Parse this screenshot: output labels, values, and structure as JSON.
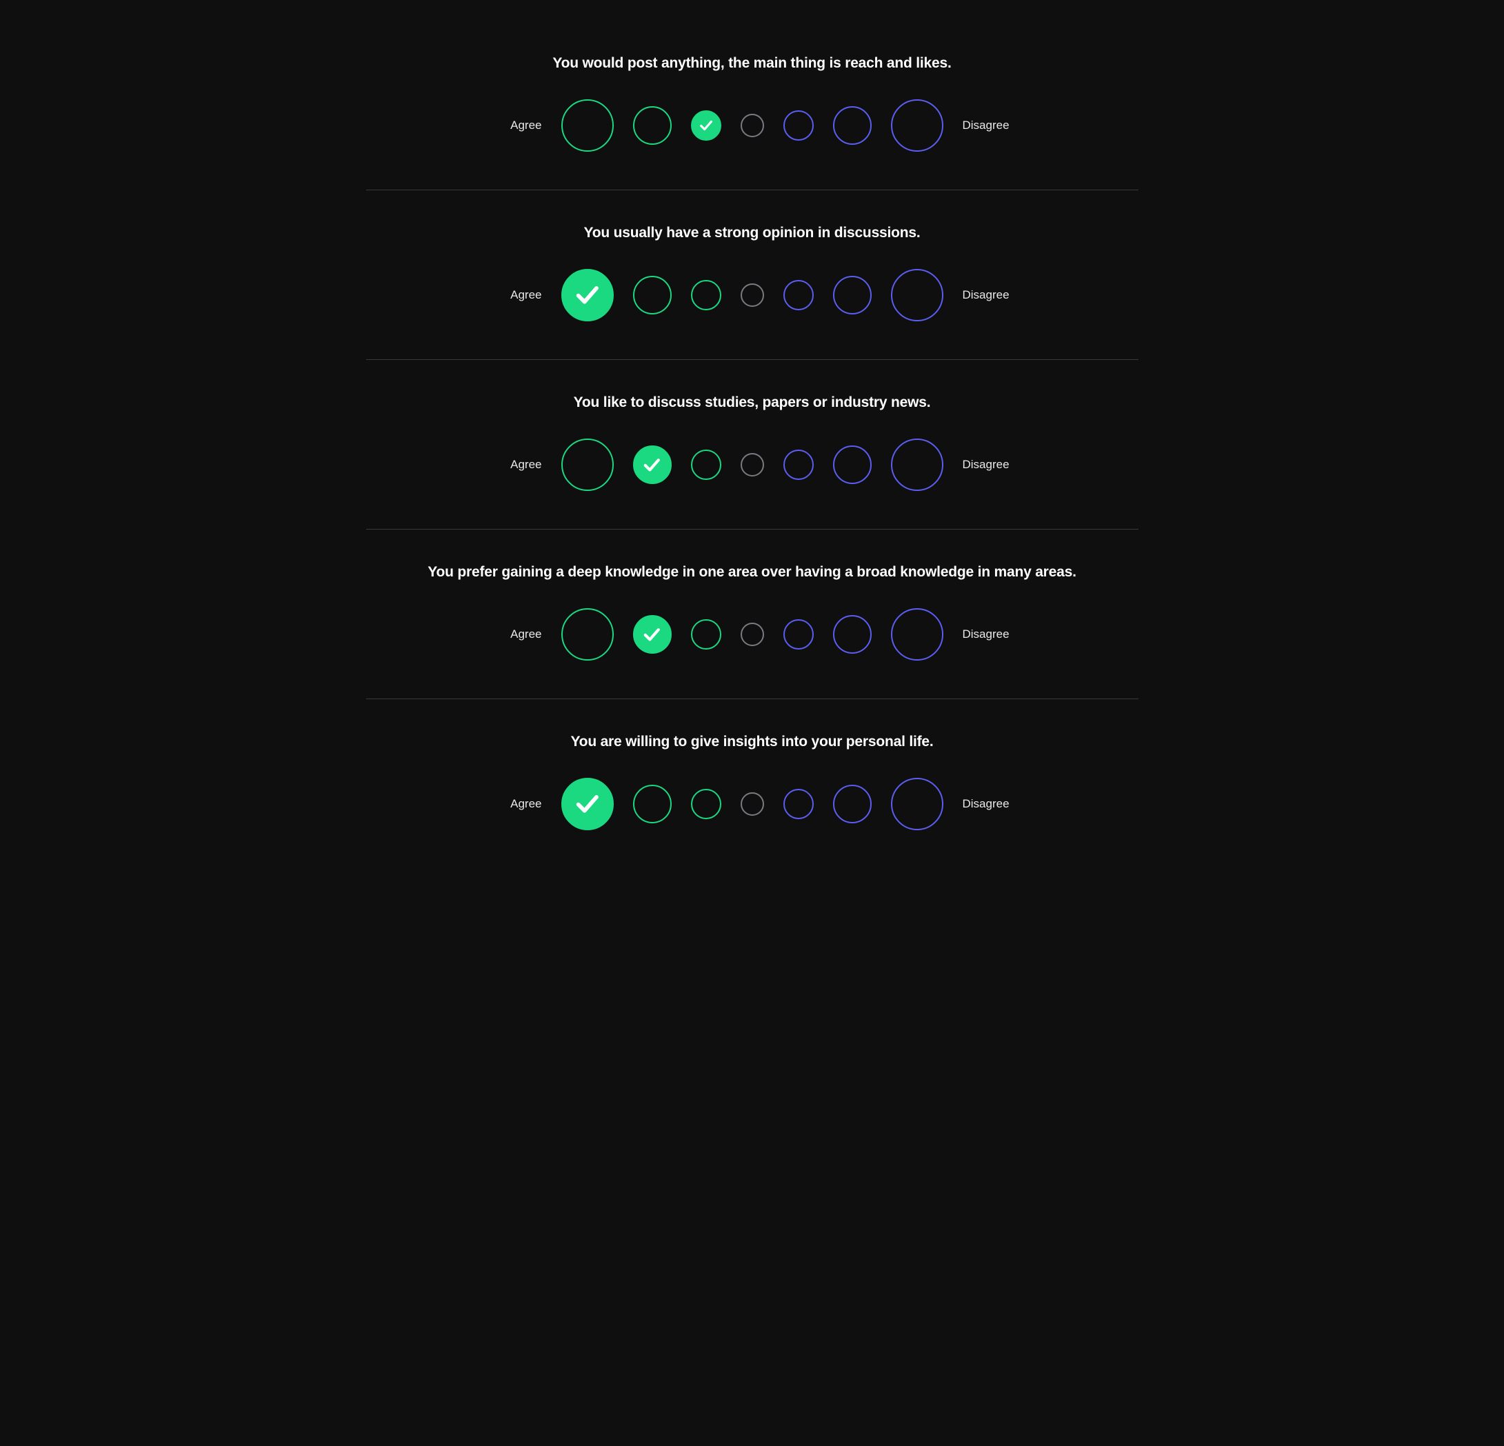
{
  "labels": {
    "agree": "Agree",
    "disagree": "Disagree"
  },
  "scale": {
    "options": [
      {
        "side": "agree",
        "size": 1
      },
      {
        "side": "agree",
        "size": 2
      },
      {
        "side": "agree",
        "size": 3
      },
      {
        "side": "neutral",
        "size": 4
      },
      {
        "side": "disagree",
        "size": 3
      },
      {
        "side": "disagree",
        "size": 2
      },
      {
        "side": "disagree",
        "size": 1
      }
    ]
  },
  "questions": [
    {
      "text": "You would post anything, the main thing is reach and likes.",
      "selected": 2
    },
    {
      "text": "You usually have a strong opinion in discussions.",
      "selected": 0
    },
    {
      "text": "You like to discuss studies, papers or industry news.",
      "selected": 1
    },
    {
      "text": "You prefer gaining a deep knowledge in one area over having a broad knowledge in many areas.",
      "selected": 1
    },
    {
      "text": "You are willing to give insights into your personal life.",
      "selected": 0
    }
  ],
  "colors": {
    "agree": "#1bd981",
    "neutral": "#7a7a80",
    "disagree": "#5b5ef0",
    "background": "#0f0f10"
  }
}
